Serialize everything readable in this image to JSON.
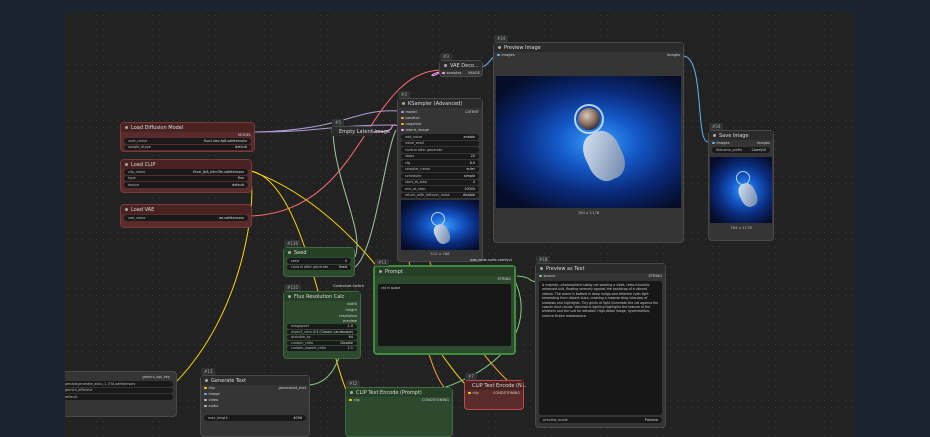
{
  "canvas": {
    "background": "#222222"
  },
  "nodes": {
    "vae_decode": {
      "tag": "#3",
      "title": "VAE Deco...",
      "inputs": [
        "samples",
        "vae"
      ],
      "output": "IMAGE"
    },
    "preview_image": {
      "tag": "#24",
      "title": "Preview Image",
      "input": "images",
      "output": "images",
      "caption": "784 x 1176"
    },
    "ksampler": {
      "tag": "#3",
      "title": "KSampler (Advanced)",
      "inputs": [
        "model",
        "positive",
        "negative",
        "latent_image"
      ],
      "output": "LATENT",
      "widgets": [
        {
          "label": "add_noise",
          "value": "enable"
        },
        {
          "label": "noise_seed",
          "value": ""
        },
        {
          "label": "control after generate",
          "value": ""
        },
        {
          "label": "steps",
          "value": "20"
        },
        {
          "label": "cfg",
          "value": "8.0"
        },
        {
          "label": "sampler_name",
          "value": "euler"
        },
        {
          "label": "scheduler",
          "value": "simple"
        },
        {
          "label": "start_at_step",
          "value": "0"
        },
        {
          "label": "end_at_step",
          "value": "10000"
        },
        {
          "label": "return_with_leftover_noise",
          "value": "disable"
        }
      ],
      "caption": "512 x 768"
    },
    "save_image": {
      "tag": "#24",
      "title": "Save Image",
      "input": "images",
      "output": "images",
      "prefix_label": "filename_prefix",
      "prefix_value": "ComfyUI",
      "caption": "784 x 1176"
    },
    "load_diffusion": {
      "title": "Load Diffusion Model",
      "output": "MODEL",
      "widgets": [
        {
          "label": "unet_name",
          "value": "flux1-dev-fp8.safetensors"
        },
        {
          "label": "weight_dtype",
          "value": "default"
        }
      ]
    },
    "empty_latent": {
      "tag": "#5",
      "title": "Empty Latent Image",
      "output": "LATENT"
    },
    "load_clip": {
      "title": "Load CLIP",
      "output": "CLIP",
      "widgets": [
        {
          "label": "clip_name",
          "value": "t5xxl_fp8_e4m3fn.safetensors"
        },
        {
          "label": "type",
          "value": "flux"
        },
        {
          "label": "device",
          "value": "default"
        }
      ]
    },
    "load_vae": {
      "title": "Load VAE",
      "output": "VAE",
      "widgets": [
        {
          "label": "vae_name",
          "value": "ae.safetensors"
        }
      ]
    },
    "seed": {
      "tag": "#136",
      "title": "Seed",
      "output": "INT",
      "widgets": [
        {
          "label": "seed",
          "value": "0"
        },
        {
          "label": "control after generate",
          "value": "fixed"
        }
      ]
    },
    "flux_res": {
      "tag": "#135",
      "title": "Flux Resolution Calc",
      "widgets": [
        {
          "label": "megapixel",
          "value": "1.0"
        },
        {
          "label": "aspect_ratio",
          "value": "4:3 (Classic Landscape)"
        },
        {
          "label": "divisible_by",
          "value": "64"
        },
        {
          "label": "custom_ratio",
          "value": "Disable"
        },
        {
          "label": "custom_aspect_ratio",
          "value": "1:1"
        }
      ],
      "outputs": [
        "width",
        "height",
        "resolution",
        "preview"
      ],
      "badge": "Controlnet Switch"
    },
    "prompt": {
      "tag": "#11",
      "title": "Prompt",
      "output": "STRING",
      "text": "cat in space",
      "badge": "was-node-suite-comfyui"
    },
    "preview_text": {
      "tag": "#18",
      "title": "Preview as Text",
      "input": "source",
      "output": "STRING",
      "text": "A majestic, photorealistic tabby cat wearing a sleek, retro-futuristic astronaut suit, floating serenely against the backdrop of a vibrant nebula. The scene is bathed in deep indigo and ethereal cyan light emanating from distant stars, creating a mesmerizing interplay of shadows and highlights. Tiny glints of light illuminate the cat against the cosmic dust clouds. Volumetric lighting highlights the texture of the whiskers and the suit fur detailed. High-detail image, hyperrealistic, science fiction masterpiece.",
      "footer_left": "preview_mode",
      "footer_right": "Preview"
    },
    "gen_text_left": {
      "outputs": [
        {
          "label": "gemini_api_key",
          "value": "genaixigenerate_aistu_1_5?A.safetensors"
        },
        {
          "label": "model",
          "value": "gemini_efficient"
        },
        {
          "label": "",
          "value": "default"
        }
      ]
    },
    "generate_text": {
      "tag": "#13",
      "title": "Generate Text",
      "inputs": [
        "clip",
        "image",
        "video",
        "audio"
      ],
      "output": "generated_text",
      "widget": {
        "label": "max_length",
        "value": "4096"
      }
    },
    "clip_prompt": {
      "tag": "#12",
      "title": "CLIP Text Encode (Prompt)",
      "input": "clip",
      "output": "CONDITIONING"
    },
    "clip_neg": {
      "tag": "#7",
      "title": "CLIP Text Encode (N...",
      "input": "clip",
      "output": "CONDITIONING"
    }
  },
  "colors": {
    "model": "#b19cd9",
    "clip": "#ffd500",
    "vae": "#ff6e6e",
    "latent": "#ff9cf9",
    "image": "#64b5f6",
    "conditioning": "#ffa931",
    "int": "#a0c8a0",
    "string": "#7ecf7e"
  }
}
